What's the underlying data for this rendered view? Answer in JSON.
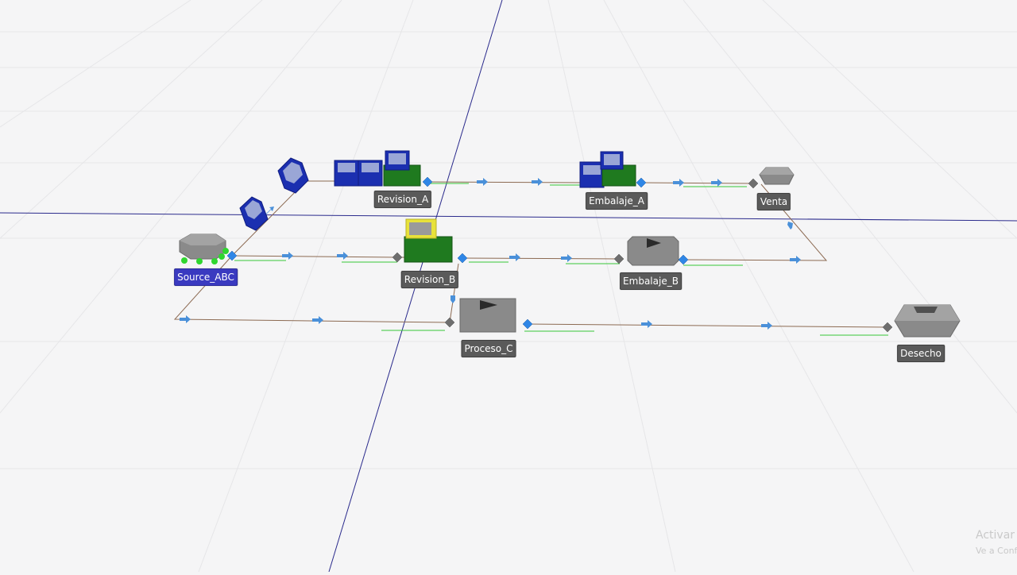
{
  "labels": {
    "source": "Source_ABC",
    "revision_a": "Revision_A",
    "revision_b": "Revision_B",
    "embalaje_a": "Embalaje_A",
    "embalaje_b": "Embalaje_B",
    "proceso_c": "Proceso_C",
    "venta": "Venta",
    "desecho": "Desecho"
  },
  "watermark": {
    "line1": "Activar",
    "line2": "Ve a Conf"
  },
  "colors": {
    "background": "#f5f5f6",
    "grid": "#e6e6e8",
    "axis": "#2a2a8c",
    "connector": "#8c6a52",
    "arrow": "#4a90d9",
    "port": "#2f86e6",
    "input_port": "#6e6e6e",
    "queue_line": "#38c738",
    "box_gray": "#8a8a8a",
    "box_green": "#1f7a1f",
    "box_blue": "#1b2fb0",
    "highlight_yellow": "#e8e23a",
    "label_bg": "#5a5a5a",
    "label_selected_bg": "#3a3ac0"
  }
}
